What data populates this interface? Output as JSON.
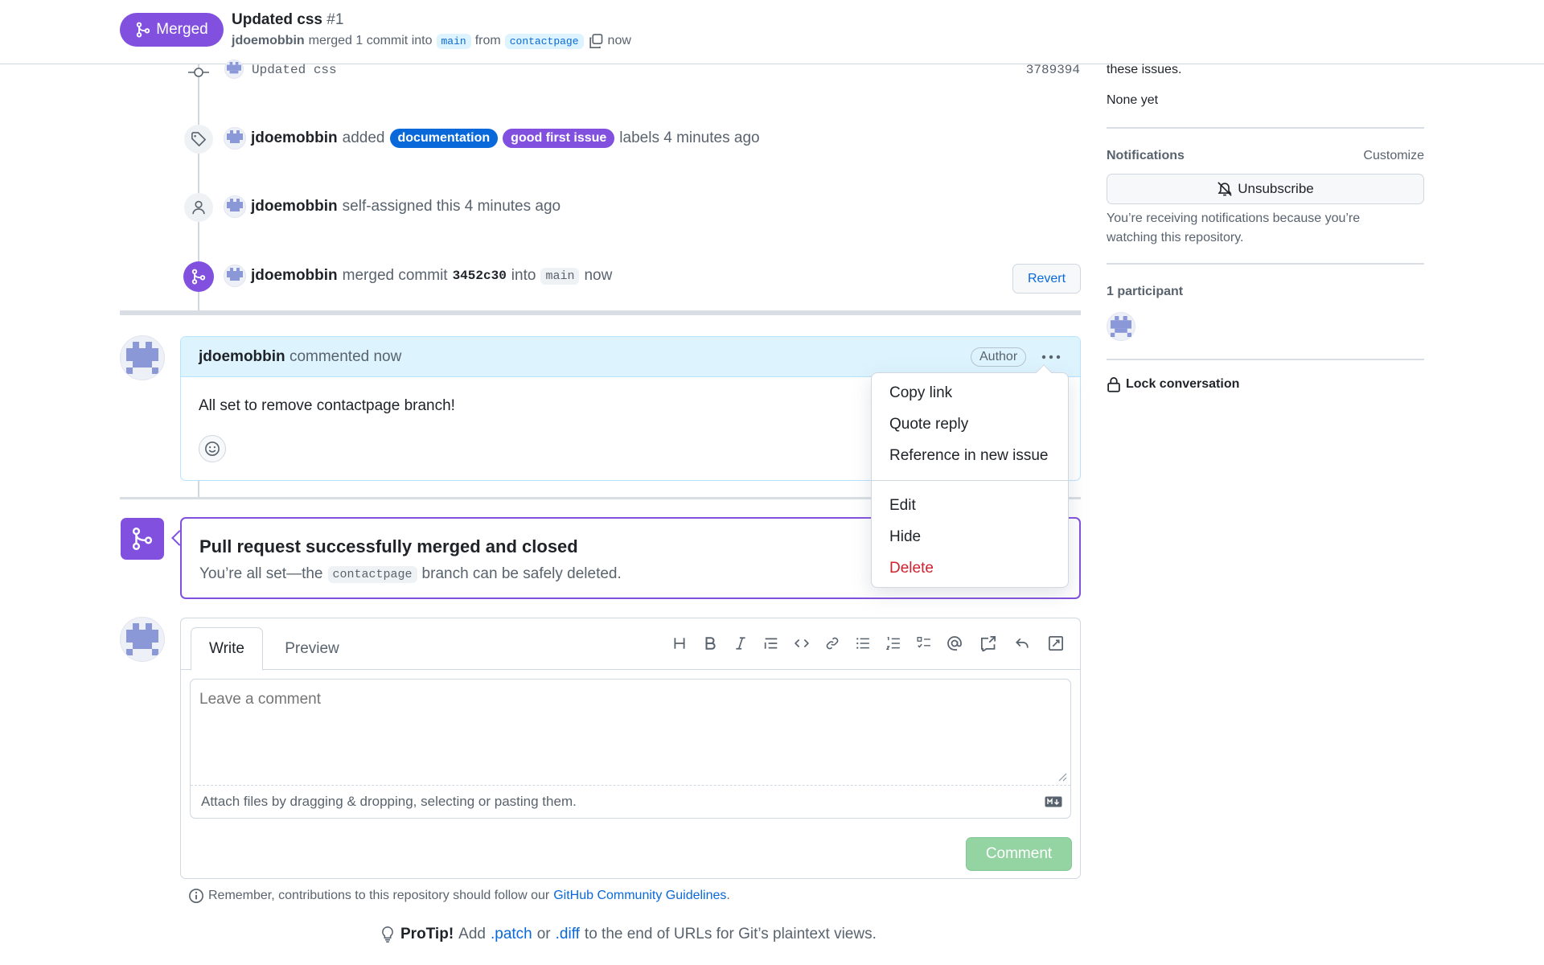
{
  "header": {
    "state_label": "Merged",
    "title": "Updated css",
    "number": "#1",
    "author": "jdoemobbin",
    "merged_text": "merged 1 commit into",
    "base_branch": "main",
    "from_text": "from",
    "head_branch": "contactpage",
    "time": "now"
  },
  "timeline": {
    "commit": {
      "message": "Updated css",
      "sha": "3789394"
    },
    "labels_event": {
      "actor": "jdoemobbin",
      "verb": "added",
      "labels": [
        {
          "name": "documentation",
          "color": "#0969da"
        },
        {
          "name": "good first issue",
          "color": "#8250df"
        }
      ],
      "suffix": "labels 4 minutes ago"
    },
    "assign_event": {
      "actor": "jdoemobbin",
      "text": "self-assigned this 4 minutes ago"
    },
    "merge_event": {
      "actor": "jdoemobbin",
      "verb": "merged commit",
      "sha": "3452c30",
      "into": "into",
      "branch": "main",
      "time": "now",
      "revert_label": "Revert"
    }
  },
  "comment": {
    "author": "jdoemobbin",
    "meta": "commented now",
    "badge": "Author",
    "body": "All set to remove contactpage branch!"
  },
  "context_menu": {
    "items": [
      "Copy link",
      "Quote reply",
      "Reference in new issue"
    ],
    "items2": [
      "Edit",
      "Hide"
    ],
    "danger": "Delete"
  },
  "merged_box": {
    "title": "Pull request successfully merged and closed",
    "text_before": "You’re all set—the",
    "branch": "contactpage",
    "text_after": "branch can be safely deleted."
  },
  "editor": {
    "tabs": [
      "Write",
      "Preview"
    ],
    "placeholder": "Leave a comment",
    "attach_hint": "Attach files by dragging & dropping, selecting or pasting them.",
    "submit_label": "Comment",
    "toolbar_icons": [
      "heading-icon",
      "bold-icon",
      "italic-icon",
      "quote-icon",
      "code-icon",
      "link-icon",
      "bulleted-list-icon",
      "numbered-list-icon",
      "task-list-icon",
      "mention-icon",
      "cross-reference-icon",
      "saved-reply-icon",
      "fullscreen-icon"
    ]
  },
  "footer": {
    "guidelines_prefix": "Remember, contributions to this repository should follow our",
    "guidelines_link": "GitHub Community Guidelines",
    "guidelines_suffix": ".",
    "protip_label": "ProTip!",
    "protip_add": "Add",
    "patch_link": ".patch",
    "or": "or",
    "diff_link": ".diff",
    "protip_suffix": "to the end of URLs for Git’s plaintext views."
  },
  "sidebar": {
    "issues_text": "these issues.",
    "none_yet": "None yet",
    "notifications_heading": "Notifications",
    "customize_label": "Customize",
    "unsubscribe_label": "Unsubscribe",
    "notification_reason": "You’re receiving notifications because you’re watching this repository.",
    "participants_heading": "1 participant",
    "lock_label": "Lock conversation"
  },
  "colors": {
    "merged_purple": "#8250df",
    "link_blue": "#0969da",
    "comment_header_bg": "#ddf4ff",
    "danger_red": "#cf222e",
    "submit_disabled": "#94d3a2"
  }
}
